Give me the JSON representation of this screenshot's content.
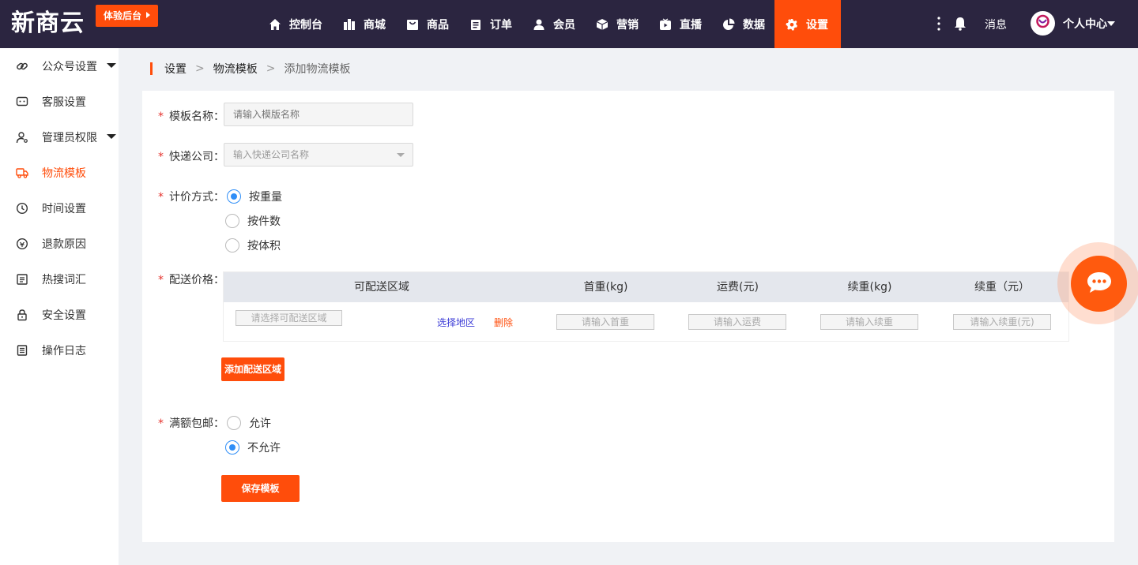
{
  "header": {
    "logo": "新商云",
    "trial_label": "体验后台",
    "nav": [
      {
        "label": "控制台",
        "icon": "home-icon"
      },
      {
        "label": "商城",
        "icon": "building-icon"
      },
      {
        "label": "商品",
        "icon": "bag-icon"
      },
      {
        "label": "订单",
        "icon": "clipboard-icon"
      },
      {
        "label": "会员",
        "icon": "user-icon"
      },
      {
        "label": "营销",
        "icon": "box-icon"
      },
      {
        "label": "直播",
        "icon": "tv-icon"
      },
      {
        "label": "数据",
        "icon": "pie-icon"
      },
      {
        "label": "设置",
        "icon": "gear-icon",
        "active": true
      }
    ],
    "messages_label": "消息",
    "user_label": "个人中心"
  },
  "sidebar": {
    "items": [
      {
        "label": "公众号设置",
        "icon": "link-icon"
      },
      {
        "label": "客服设置",
        "icon": "chat-icon"
      },
      {
        "label": "管理员权限",
        "icon": "admin-icon"
      },
      {
        "label": "物流模板",
        "icon": "truck-icon",
        "active": true
      },
      {
        "label": "时间设置",
        "icon": "clock-icon"
      },
      {
        "label": "退款原因",
        "icon": "refund-icon"
      },
      {
        "label": "热搜词汇",
        "icon": "list-icon"
      },
      {
        "label": "安全设置",
        "icon": "lock-icon"
      },
      {
        "label": "操作日志",
        "icon": "log-icon"
      }
    ]
  },
  "breadcrumb": {
    "level1": "设置",
    "level2": "物流模板",
    "level3": "添加物流模板",
    "separator": ">"
  },
  "form": {
    "name_label": "模板名称：",
    "name_placeholder": "请输入模版名称",
    "company_label": "快递公司：",
    "company_placeholder": "输入快递公司名称",
    "pricing_label": "计价方式：",
    "pricing_options": [
      "按重量",
      "按件数",
      "按体积"
    ],
    "pricing_selected": "按重量",
    "delivery_label": "配送价格：",
    "table_headers": [
      "可配送区域",
      "首重(kg)",
      "运费(元)",
      "续重(kg)",
      "续重（元）"
    ],
    "row": {
      "area_placeholder": "请选择可配送区域",
      "select_region": "选择地区",
      "delete": "删除",
      "first_weight_placeholder": "请输入首重",
      "fee_placeholder": "请输入运费",
      "extra_weight_placeholder": "请输入续重",
      "extra_fee_placeholder": "请输入续重(元)"
    },
    "add_area_button": "添加配送区域",
    "free_shipping_label": "满额包邮：",
    "free_shipping_options": [
      "允许",
      "不允许"
    ],
    "free_shipping_selected": "不允许",
    "save_button": "保存模板",
    "required_mark": "*"
  },
  "colors": {
    "accent": "#ff4d0b",
    "topbar": "#2b2540",
    "radio_on": "#2f8ef7"
  }
}
